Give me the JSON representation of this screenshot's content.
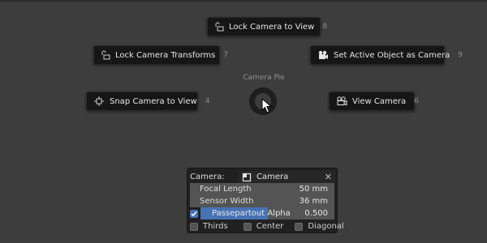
{
  "pie": {
    "title": "Camera Pie",
    "items": [
      {
        "label": "Lock Camera to View",
        "shortcut": "8",
        "icon": "lock-camera-icon"
      },
      {
        "label": "Lock Camera Transforms",
        "shortcut": "7",
        "icon": "lock-camera-icon"
      },
      {
        "label": "Set Active Object as Camera",
        "shortcut": "9",
        "icon": "camera-icon"
      },
      {
        "label": "Snap Camera to View",
        "shortcut": "4",
        "icon": "snap-camera-icon"
      },
      {
        "label": "View Camera",
        "shortcut": "6",
        "icon": "view-camera-icon"
      }
    ]
  },
  "panel": {
    "camera_label": "Camera:",
    "camera_value": "Camera",
    "camera_icon": "camera-object-icon",
    "focal_length_label": "Focal Length",
    "focal_length_value": "50 mm",
    "sensor_width_label": "Sensor Width",
    "sensor_width_value": "36 mm",
    "passepartout_label": "Passepartout Alpha",
    "passepartout_value": "0.500",
    "passepartout_fraction": 0.5,
    "passepartout_checked": true,
    "guides": [
      {
        "label": "Thirds",
        "checked": false
      },
      {
        "label": "Center",
        "checked": false
      },
      {
        "label": "Diagonal",
        "checked": false
      }
    ]
  },
  "colors": {
    "background": "#3d3d3d",
    "button": "#161616",
    "accent": "#4772b3"
  }
}
